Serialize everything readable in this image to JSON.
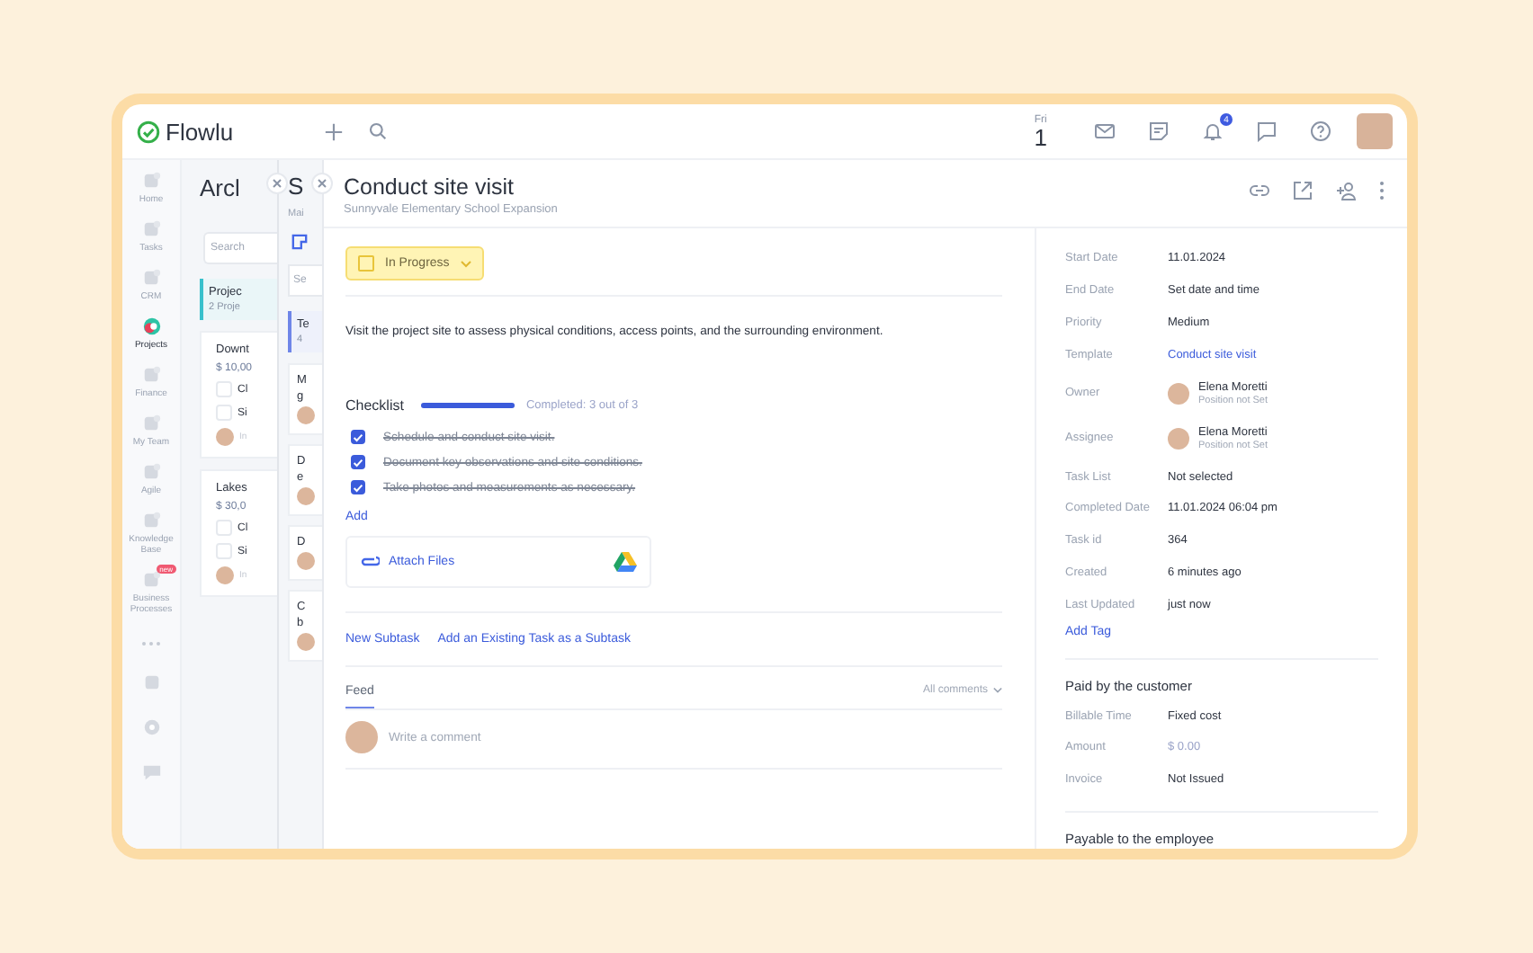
{
  "topbar": {
    "logo": "Flowlu",
    "weekday": "Fri",
    "day": "1",
    "notifications": "4"
  },
  "nav": [
    {
      "label": "Home",
      "selected": false
    },
    {
      "label": "Tasks",
      "selected": false
    },
    {
      "label": "CRM",
      "selected": false
    },
    {
      "label": "Projects",
      "selected": true
    },
    {
      "label": "Finance",
      "selected": false
    },
    {
      "label": "My Team",
      "selected": false
    },
    {
      "label": "Agile",
      "selected": false
    },
    {
      "label": "Knowledge Base",
      "selected": false
    },
    {
      "label": "Business Processes",
      "selected": false,
      "badge": "new"
    }
  ],
  "panel_1": {
    "title": "Arcl",
    "search_placeholder": "Search",
    "group": {
      "title": "Projec",
      "count": "2 Proje"
    },
    "cards": [
      {
        "title": "Downt",
        "amount": "$ 10,00",
        "checks": [
          {
            "text": "Cl",
            "checked": false
          },
          {
            "text": "Si",
            "checked": false
          }
        ],
        "assignee": "In"
      },
      {
        "title": "Lakes",
        "amount": "$ 30,0",
        "checks": [
          {
            "text": "Cl",
            "checked": false
          },
          {
            "text": "Si",
            "checked": false
          }
        ],
        "assignee": "In"
      }
    ]
  },
  "panel_2": {
    "title": "S",
    "subtitle": "Mai",
    "search_placeholder": "Se",
    "group": {
      "title": "Te",
      "count": "4"
    },
    "cards": [
      {
        "lines": [
          "M",
          "g"
        ]
      },
      {
        "lines": [
          "D",
          "e"
        ]
      },
      {
        "lines": [
          "D"
        ]
      },
      {
        "lines": [
          "C",
          "b"
        ]
      }
    ]
  },
  "task": {
    "title": "Conduct site visit",
    "project": "Sunnyvale Elementary School Expansion",
    "status": "In Progress",
    "description": "Visit the project site to assess physical conditions, access points, and the surrounding environment.",
    "checklist": {
      "title": "Checklist",
      "level": 1,
      "summary": "Completed: 3 out of 3",
      "add": "Add",
      "items": [
        {
          "text": "Schedule and conduct site visit.",
          "checked": true
        },
        {
          "text": "Document key observations and site conditions.",
          "checked": true
        },
        {
          "text": "Take photos and measurements as necessary.",
          "checked": true
        }
      ]
    },
    "attach": "Attach Files",
    "subtask_links": [
      "New Subtask",
      "Add an Existing Task as a Subtask"
    ],
    "feed": {
      "tabs": [
        {
          "label": "Feed",
          "selected": true
        }
      ],
      "filter": "All comments",
      "comment_placeholder": "Write a comment"
    }
  },
  "details": {
    "fields": [
      {
        "kind": "text",
        "label": "Start Date",
        "value": "11.01.2024"
      },
      {
        "kind": "text",
        "label": "End Date",
        "value": "Set date and time"
      },
      {
        "kind": "text",
        "label": "Priority",
        "value": "Medium"
      },
      {
        "kind": "link",
        "label": "Template",
        "value": "Conduct site visit"
      },
      {
        "kind": "person",
        "label": "Owner",
        "value": "Elena Moretti",
        "note": "Position not Set"
      },
      {
        "kind": "person",
        "label": "Assignee",
        "value": "Elena Moretti",
        "note": "Position not Set"
      },
      {
        "kind": "text",
        "label": "Task List",
        "value": "Not selected"
      },
      {
        "kind": "text",
        "label": "Completed Date",
        "value": "11.01.2024 06:04 pm"
      },
      {
        "kind": "text",
        "label": "Task id",
        "value": "364"
      },
      {
        "kind": "text",
        "label": "Created",
        "value": "6 minutes ago"
      },
      {
        "kind": "text",
        "label": "Last Updated",
        "value": "just now"
      }
    ],
    "add_tag": "Add Tag",
    "sections": [
      {
        "title": "Paid by the customer",
        "fields": [
          {
            "kind": "text",
            "label": "Billable Time",
            "value": "Fixed cost"
          },
          {
            "kind": "muted",
            "label": "Amount",
            "value": "$ 0.00"
          },
          {
            "kind": "text",
            "label": "Invoice",
            "value": "Not Issued"
          }
        ]
      },
      {
        "title": "Payable to the employee"
      }
    ]
  }
}
